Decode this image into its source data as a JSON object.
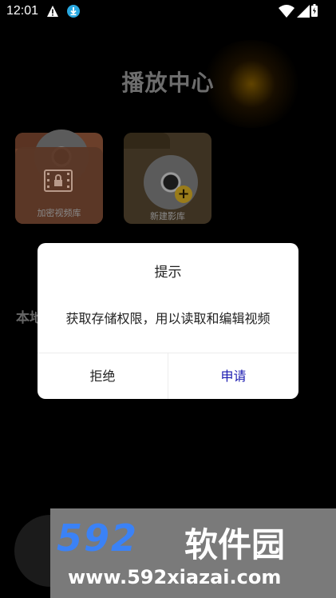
{
  "status_bar": {
    "time": "12:01"
  },
  "screen": {
    "title": "播放中心",
    "folders": [
      {
        "label": "加密视频库"
      },
      {
        "label": "新建影库"
      }
    ],
    "partial_text": "本地"
  },
  "dialog": {
    "title": "提示",
    "message": "获取存储权限，用以读取和编辑视频",
    "deny_label": "拒绝",
    "apply_label": "申请"
  },
  "watermark": {
    "logo": "592",
    "name": "软件园",
    "url": "www.592xiazai.com"
  }
}
